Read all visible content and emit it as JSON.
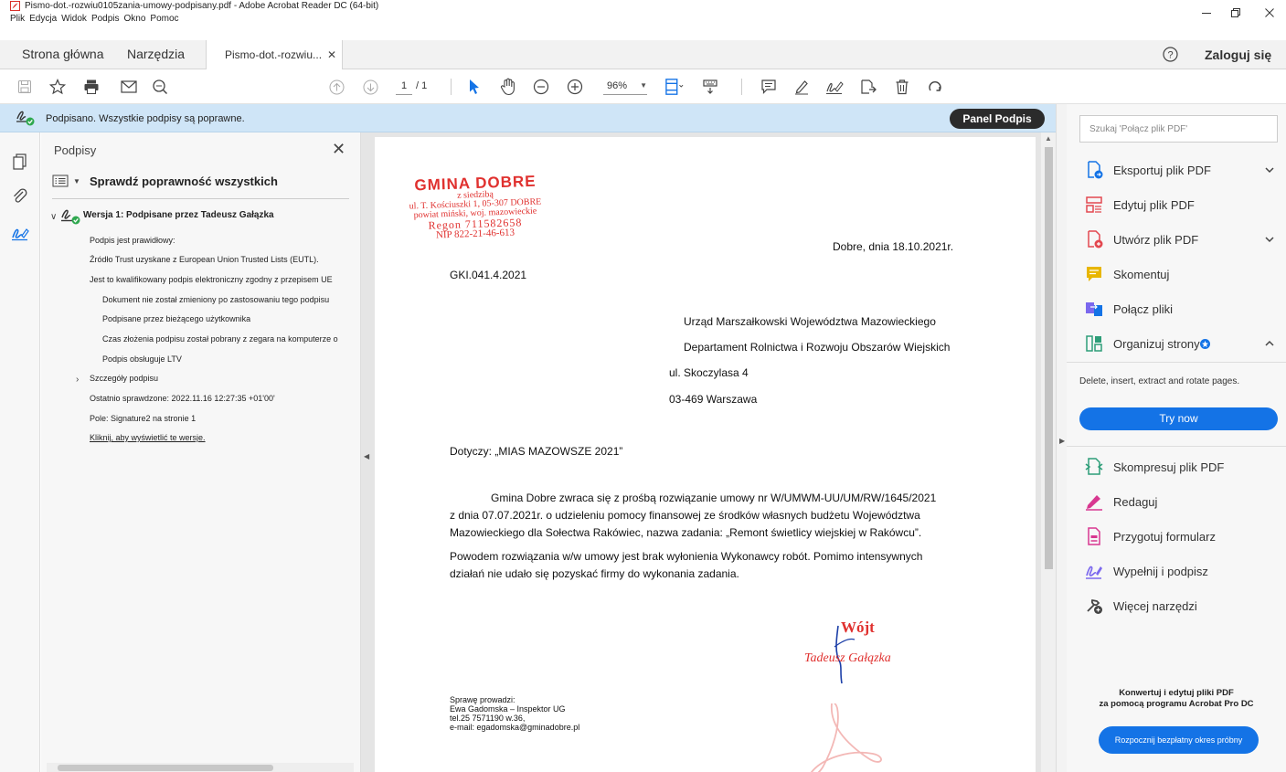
{
  "window": {
    "title": "Pismo-dot.-rozwiu0105zania-umowy-podpisany.pdf - Adobe Acrobat Reader DC (64-bit)",
    "menu": [
      "Plik",
      "Edycja",
      "Widok",
      "Podpis",
      "Okno",
      "Pomoc"
    ]
  },
  "tabs": {
    "home": "Strona główna",
    "tools": "Narzędzia",
    "document": "Pismo-dot.-rozwiu...",
    "login": "Zaloguj się"
  },
  "toolbar": {
    "page_current": "1",
    "page_total": "/ 1",
    "zoom": "96%"
  },
  "banner": {
    "message": "Podpisano. Wszystkie podpisy są poprawne.",
    "panel_button": "Panel Podpis"
  },
  "signatures": {
    "title": "Podpisy",
    "verify_all": "Sprawdź poprawność wszystkich",
    "version": "Wersja 1: Podpisane przez Tadeusz Gałązka",
    "lines": [
      "Podpis jest prawidłowy:",
      "Źródło Trust uzyskane z European Union Trusted Lists (EUTL).",
      "Jest to kwalifikowany podpis elektroniczny zgodny z przepisem UE",
      "Dokument nie został zmieniony po zastosowaniu tego podpisu",
      "Podpisane przez bieżącego użytkownika",
      "Czas złożenia podpisu został pobrany z zegara na komputerze o",
      "Podpis obsługuje LTV"
    ],
    "details": "Szczegóły podpisu",
    "last_checked": "Ostatnio sprawdzone: 2022.11.16 12:27:35 +01'00'",
    "field": "Pole: Signature2 na stronie 1",
    "show_version_link": "Kliknij, aby wyświetlić te wersje."
  },
  "document": {
    "stamp": {
      "line1": "GMINA DOBRE",
      "line2": "z siedzibą",
      "line3": "ul. T. Kościuszki 1, 05-307 DOBRE",
      "line4": "powiat miński, woj. mazowieckie",
      "line5": "Regon 711582658",
      "line6": "NIP 822-21-46-613"
    },
    "date": "Dobre, dnia 18.10.2021r.",
    "reference": "GKI.041.4.2021",
    "recipient": [
      "Urząd Marszałkowski Województwa Mazowieckiego",
      "Departament Rolnictwa i Rozwoju Obszarów Wiejskich",
      "ul. Skoczylasa 4",
      "03-469 Warszawa"
    ],
    "subject": "Dotyczy: „MIAS MAZOWSZE 2021”",
    "paragraph1": [
      "Gmina Dobre zwraca się z prośbą rozwiązanie umowy nr W/UMWM-UU/UM/RW/1645/2021",
      "z dnia 07.07.2021r. o udzieleniu pomocy finansowej ze środków własnych budżetu Województwa",
      "Mazowieckiego dla  Sołectwa Rakówiec, nazwa zadania: „Remont świetlicy wiejskiej w Rakówcu”."
    ],
    "paragraph2": [
      "Powodem rozwiązania w/w umowy jest brak wyłonienia Wykonawcy robót. Pomimo intensywnych",
      "działań nie udało się pozyskać firmy do wykonania zadania."
    ],
    "signer_title": "Wójt",
    "signer_name": "Tadeusz Gałązka",
    "footer": [
      "Sprawę prowadzi:",
      "Ewa Gadomska – Inspektor UG",
      "tel.25 7571190 w.36,",
      "e-mail: egadomska@gminadobre.pl"
    ]
  },
  "right_pane": {
    "search_placeholder": "Szukaj 'Połącz plik PDF'",
    "tools_top": [
      {
        "label": "Eksportuj plik PDF",
        "icon": "export-pdf-icon",
        "color": "#1473e6"
      },
      {
        "label": "Edytuj plik PDF",
        "icon": "edit-pdf-icon",
        "color": "#e34850"
      },
      {
        "label": "Utwórz plik PDF",
        "icon": "create-pdf-icon",
        "color": "#e34850"
      },
      {
        "label": "Skomentuj",
        "icon": "comment-icon",
        "color": "#e8b600"
      },
      {
        "label": "Połącz pliki",
        "icon": "combine-files-icon",
        "color": "#7b68ee"
      },
      {
        "label": "Organizuj strony",
        "icon": "organize-pages-icon",
        "color": "#2d9d78"
      }
    ],
    "organize_description": "Delete, insert, extract and rotate pages.",
    "try_now": "Try now",
    "tools_bottom": [
      {
        "label": "Skompresuj plik PDF",
        "icon": "compress-pdf-icon",
        "color": "#2d9d78"
      },
      {
        "label": "Redaguj",
        "icon": "redact-icon",
        "color": "#d83790"
      },
      {
        "label": "Przygotuj formularz",
        "icon": "prepare-form-icon",
        "color": "#d83790"
      },
      {
        "label": "Wypełnij i podpisz",
        "icon": "fill-sign-icon",
        "color": "#7b68ee"
      },
      {
        "label": "Więcej narzędzi",
        "icon": "more-tools-icon",
        "color": "#444444"
      }
    ],
    "promo": [
      "Konwertuj i edytuj pliki PDF",
      "za pomocą programu Acrobat Pro DC"
    ],
    "trial_button": "Rozpocznij bezpłatny okres próbny"
  },
  "colors": {
    "accent": "#1473e6",
    "banner_bg": "#cfe5f7",
    "stamp_red": "#e0312f",
    "valid_green": "#2fa84f"
  }
}
